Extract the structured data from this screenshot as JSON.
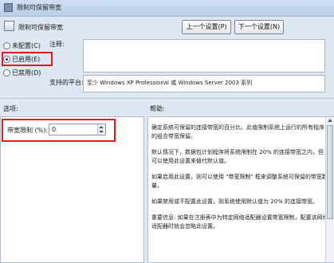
{
  "window": {
    "title": "限制可保留带宽"
  },
  "header": {
    "policy_name": "限制可保留带宽"
  },
  "nav": {
    "prev_label": "上一个设置(P)",
    "next_label": "下一个设置(N)"
  },
  "state": {
    "options": [
      {
        "label": "未配置(C)",
        "selected": false
      },
      {
        "label": "已启用(E)",
        "selected": true
      },
      {
        "label": "已禁用(D)",
        "selected": false
      }
    ]
  },
  "comment": {
    "label": "注释:",
    "value": ""
  },
  "supported": {
    "label": "支持的平台:",
    "value": "至少 Windows XP Professional 或 Windows Server 2003 系列"
  },
  "sections": {
    "options_label": "选项:",
    "help_label": "帮助:"
  },
  "options_panel": {
    "bandwidth_label": "带宽限制 (%):",
    "bandwidth_value": "0"
  },
  "help": {
    "paragraphs": [
      "确定系统可保留的连接带宽的百分比。此值限制系统上运行的所有程序的组合带宽保留。",
      "默认情况下，数据包计划程序将系统限制在 20% 的连接带宽之内，但可以使用此设置来替代默认值。",
      "如果启用此设置，则可以使用 \"带宽限制\" 框来调整系统可保留的带宽数量。",
      "如果禁用或不配置此设置，则系统使用默认值为 20% 的连接带宽。",
      "重要信息: 如果在注册表中为特定网络适配器设置带宽限制，配置该网络适配器时就会忽略此设置。"
    ]
  },
  "colors": {
    "highlight": "#e11b1b",
    "background": "#dfe8f2"
  }
}
